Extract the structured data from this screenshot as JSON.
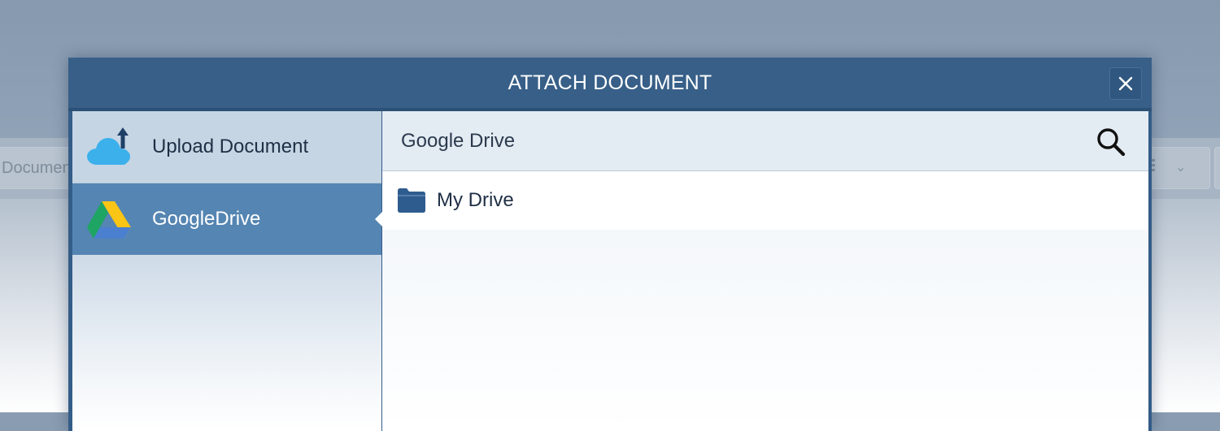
{
  "background": {
    "field_text": "Documen"
  },
  "dialog": {
    "title": "ATTACH DOCUMENT",
    "close_icon": "close-icon"
  },
  "sidebar": {
    "items": [
      {
        "label": "Upload Document",
        "icon": "cloud-upload-icon",
        "active": false
      },
      {
        "label": "GoogleDrive",
        "icon": "google-drive-icon",
        "active": true
      }
    ]
  },
  "content": {
    "title": "Google Drive",
    "search_icon": "search-icon",
    "files": [
      {
        "label": "My Drive",
        "icon": "folder-icon"
      }
    ]
  },
  "colors": {
    "header": "#375f88",
    "active_item": "#5585b2",
    "sidebar": "#c5d5e4",
    "content_header": "#e3ebf3",
    "folder": "#2e5c8e"
  }
}
